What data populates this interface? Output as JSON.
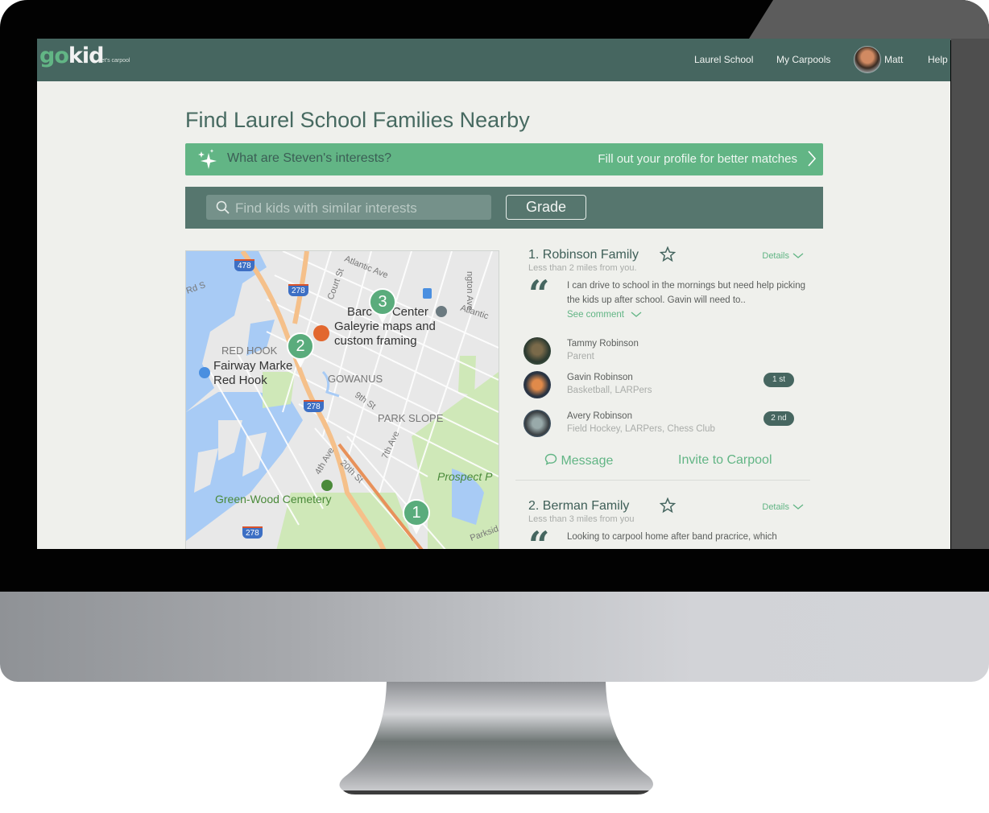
{
  "app": {
    "logo_part1": "go",
    "logo_part2": "kid",
    "tagline": "Let's carpool"
  },
  "nav": {
    "school": "Laurel School",
    "carpools": "My Carpools",
    "user": "Matt",
    "help": "Help"
  },
  "page": {
    "title": "Find Laurel School Families Nearby"
  },
  "banner": {
    "question": "What are Steven's interests?",
    "cta": "Fill out your profile for better matches"
  },
  "filters": {
    "search_placeholder": "Find kids with similar interests",
    "search_value": "",
    "grade_label": "Grade"
  },
  "map": {
    "labels": {
      "atlantic_ave": "Atlantic Ave",
      "atlantic": "Atlantic",
      "court_st": "Court St",
      "rd_s": "Rd S",
      "washington_ave": "ngton Ave",
      "red_hook": "RED HOOK",
      "fairway_1": "Fairway Marke",
      "fairway_2": "Red Hook",
      "barclays": "Barc      Center",
      "galeyrie_1": "Galeyrie maps and",
      "galeyrie_2": "custom framing",
      "gowanus": "GOWANUS",
      "ninth_st": "9th St",
      "park_slope": "PARK SLOPE",
      "seventh_ave": "7th Ave",
      "fourth_ave": "4th Ave",
      "twentieth_st": "20th St",
      "prospect": "Prospect P",
      "green_wood": "Green-Wood Cemetery",
      "parkside": "Parksid"
    },
    "shields": [
      "478",
      "278",
      "278",
      "278"
    ],
    "pins": [
      "1",
      "2",
      "3"
    ]
  },
  "families": [
    {
      "title": "1. Robinson Family",
      "distance": "Less than 2 miles from you.",
      "details_label": "Details",
      "comment": "I can drive to school in the mornings but need help picking the kids up after school. Gavin will need to..",
      "see_comment": "See comment",
      "members": [
        {
          "name": "Tammy Robinson",
          "sub": "Parent",
          "grade": ""
        },
        {
          "name": "Gavin Robinson",
          "sub": "Basketball, LARPers",
          "grade": "1 st"
        },
        {
          "name": "Avery Robinson",
          "sub": "Field Hockey, LARPers, Chess Club",
          "grade": "2 nd"
        }
      ],
      "message_label": "Message",
      "invite_label": "Invite to Carpool"
    },
    {
      "title": "2. Berman Family",
      "distance": "Less than 3 miles from you",
      "details_label": "Details",
      "comment": "Looking to carpool home after band pracrice, which"
    }
  ],
  "colors": {
    "brand_dark": "#466660",
    "brand_green": "#62b585",
    "background": "#eff0ec"
  }
}
